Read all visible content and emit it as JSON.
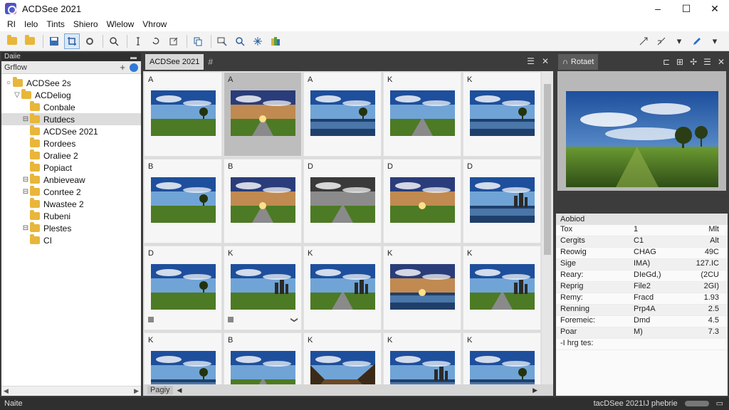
{
  "window": {
    "title": "ACDSee 2021",
    "minimize": "–",
    "maximize": "☐",
    "close": "✕"
  },
  "menu": [
    "RI",
    "Ielo",
    "Tints",
    "Shiero",
    "Wlelow",
    "Vhrow"
  ],
  "toolbar": {
    "left_icons": [
      "folder-open-icon",
      "folder-icon",
      "save-icon",
      "crop-icon",
      "gear-icon",
      "search-icon",
      "text-cursor-icon",
      "rotate-icon",
      "export-icon",
      "copy-icon",
      "filter-icon",
      "zoom-icon",
      "sparkle-icon",
      "color-icon"
    ],
    "right_icons": [
      "arrow-split-icon",
      "arrow-merge-icon",
      "dropdown-arrow-icon",
      "pen-icon",
      "dropdown-arrow-icon"
    ]
  },
  "left_panel": {
    "header": "Daiie",
    "search_text": "Grflow",
    "plus": "+",
    "tree": [
      {
        "toggle": "○",
        "label": "ACDSee 2s",
        "indent": 0,
        "selected": false
      },
      {
        "toggle": "▽",
        "label": "ACDeliog",
        "indent": 1,
        "selected": false
      },
      {
        "toggle": "",
        "label": "Conbale",
        "indent": 2,
        "selected": false
      },
      {
        "toggle": "⊟",
        "label": "Rutdecs",
        "indent": 2,
        "selected": true
      },
      {
        "toggle": "",
        "label": "ACDSee 2021",
        "indent": 2,
        "selected": false
      },
      {
        "toggle": "",
        "label": "Rordees",
        "indent": 2,
        "selected": false
      },
      {
        "toggle": "",
        "label": "Oraliee 2",
        "indent": 2,
        "selected": false
      },
      {
        "toggle": "",
        "label": "Popiact",
        "indent": 2,
        "selected": false
      },
      {
        "toggle": "⊟",
        "label": "Anbieveaw",
        "indent": 2,
        "selected": false
      },
      {
        "toggle": "⊟",
        "label": "Conrtee 2",
        "indent": 2,
        "selected": false
      },
      {
        "toggle": "",
        "label": "Nwastee 2",
        "indent": 2,
        "selected": false
      },
      {
        "toggle": "",
        "label": "Rubeni",
        "indent": 2,
        "selected": false
      },
      {
        "toggle": "⊟",
        "label": "Plestes",
        "indent": 2,
        "selected": false
      },
      {
        "toggle": "",
        "label": "CI",
        "indent": 2,
        "selected": false
      }
    ],
    "scroll_left": "◀",
    "scroll_right": "▶"
  },
  "browser": {
    "tab": "ACDSee 2021",
    "tab_extra": "#",
    "icons": [
      "menu-icon",
      "close-icon"
    ],
    "cells": [
      {
        "label": "A",
        "scene": "field",
        "selected": false
      },
      {
        "label": "A",
        "scene": "sunset-road",
        "selected": true
      },
      {
        "label": "A",
        "scene": "lake",
        "selected": false
      },
      {
        "label": "K",
        "scene": "road",
        "selected": false
      },
      {
        "label": "K",
        "scene": "lake-trees",
        "selected": false
      },
      {
        "label": "B",
        "scene": "field",
        "selected": false
      },
      {
        "label": "B",
        "scene": "sunset-road",
        "selected": false
      },
      {
        "label": "D",
        "scene": "road-bw",
        "selected": false
      },
      {
        "label": "D",
        "scene": "sunset",
        "selected": false
      },
      {
        "label": "D",
        "scene": "lake-city",
        "selected": false
      },
      {
        "label": "D",
        "scene": "field",
        "selected": false
      },
      {
        "label": "K",
        "scene": "field-towers",
        "selected": false
      },
      {
        "label": "K",
        "scene": "road-city",
        "selected": false
      },
      {
        "label": "K",
        "scene": "sunset-lake",
        "selected": false
      },
      {
        "label": "K",
        "scene": "road-city",
        "selected": false
      },
      {
        "label": "K",
        "scene": "lake",
        "selected": false
      },
      {
        "label": "B",
        "scene": "road",
        "selected": false
      },
      {
        "label": "K",
        "scene": "canyon",
        "selected": false
      },
      {
        "label": "K",
        "scene": "lake-city",
        "selected": false
      },
      {
        "label": "K",
        "scene": "lake-trees",
        "selected": false
      }
    ],
    "bottom_tab": "Pagiy",
    "bottom_arrow": "◀",
    "bottom_right_arrow": "▶"
  },
  "right_panel": {
    "tab": "Rotaet",
    "tab_prefix": "∩",
    "icons": [
      "grid-icon",
      "split-icon",
      "pin-icon",
      "menu-icon",
      "close-icon"
    ],
    "props_header": "Aobiod",
    "props": [
      {
        "key": "Tox",
        "v1": "1",
        "v2": "Mlt"
      },
      {
        "key": "Cergits",
        "v1": "C1",
        "v2": "Alt"
      },
      {
        "key": "Reowig",
        "v1": "CHAG",
        "v2": "49C"
      },
      {
        "key": "Sige",
        "v1": "IMA)",
        "v2": "127.IC"
      },
      {
        "key": "Reary:",
        "v1": "DIeGd,)",
        "v2": "(2CU"
      },
      {
        "key": "Reprig",
        "v1": "File2",
        "v2": "2GI)"
      },
      {
        "key": "Remy:",
        "v1": "Fracd",
        "v2": "1.93"
      },
      {
        "key": "Renning",
        "v1": "Prp4A",
        "v2": "2.5"
      },
      {
        "key": "Foremeic:",
        "v1": "Dmd",
        "v2": "4.5"
      },
      {
        "key": "Poar",
        "v1": "M)",
        "v2": "7.3"
      },
      {
        "key": "-I hrg tes:",
        "v1": "",
        "v2": ""
      }
    ]
  },
  "status": {
    "left": "Naite",
    "right": "tacDSee 2021IJ phebrie"
  },
  "colors": {
    "chrome_dark": "#3c3c3c",
    "selection": "#dcdcdc",
    "accent": "#2f7ad6",
    "folder": "#e8b63a"
  }
}
